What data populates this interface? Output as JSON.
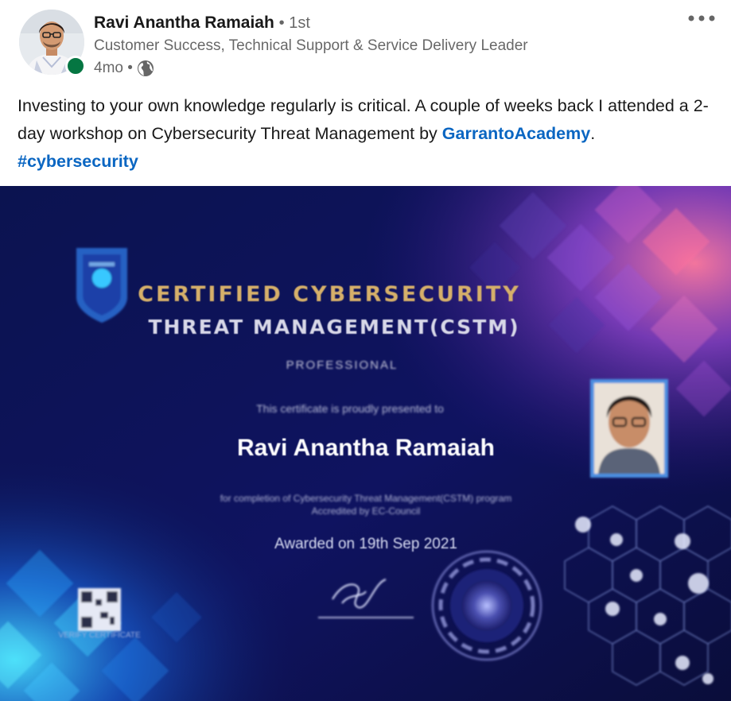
{
  "author": {
    "name": "Ravi Anantha Ramaiah",
    "degree": "• 1st",
    "headline": "Customer Success, Technical Support & Service Delivery Leader",
    "time": "4mo •",
    "presence": "online"
  },
  "post": {
    "text_before": "Investing to your own knowledge regularly is critical. A couple of weeks back I attended a 2-day workshop on Cybersecurity Threat Management by ",
    "mention": "GarrantoAcademy",
    "text_between": ". ",
    "hashtag": "#cybersecurity"
  },
  "certificate": {
    "title_line1": "CERTIFIED CYBERSECURITY",
    "title_line2": "THREAT MANAGEMENT(CSTM)",
    "level": "PROFESSIONAL",
    "presented_line": "This certificate is proudly presented to",
    "recipient": "Ravi Anantha Ramaiah",
    "reason_line1": "for completion of Cybersecurity Threat Management(CSTM) program",
    "reason_line2": "Accredited by EC-Council",
    "awarded": "Awarded on 19th Sep 2021",
    "qr_caption": "VERIFY CERTIFICATE"
  },
  "icons": {
    "more": "more-options-icon",
    "visibility": "globe-icon"
  },
  "colors": {
    "link": "#0a66c2",
    "presence": "#057642",
    "certificate_bg": "#0c1147",
    "title_gold": "#d6b06a"
  }
}
